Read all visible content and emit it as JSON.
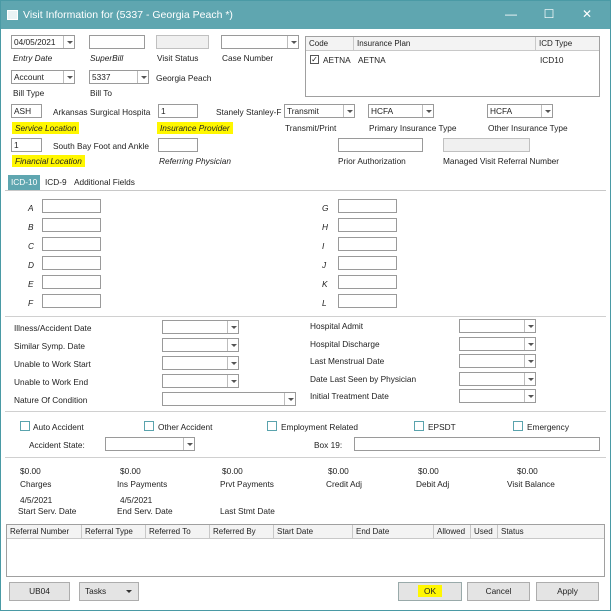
{
  "window": {
    "title": "Visit Information for (5337 - Georgia Peach *)"
  },
  "top": {
    "entry_date": "04/05/2021",
    "entry_date_label": "Entry Date",
    "superbill_label": "SuperBill",
    "visit_status_label": "Visit Status",
    "case_number_label": "Case Number",
    "bill_type_value": "Account",
    "bill_type_label": "Bill Type",
    "bill_to_value": "5337",
    "bill_to_name": "Georgia Peach",
    "bill_to_label": "Bill To",
    "service_location_code": "ASH",
    "service_location_name": "Arkansas Surgical Hospita",
    "service_location_label": "Service Location",
    "insurance_provider_code": "1",
    "insurance_provider_name": "Stanely Stanley-F",
    "insurance_provider_label": "Insurance Provider",
    "transmit_value": "Transmit",
    "transmit_label": "Transmit/Print",
    "primary_ins_type_value": "HCFA",
    "primary_ins_type_label": "Primary Insurance Type",
    "other_ins_type_value": "HCFA",
    "other_ins_type_label": "Other Insurance Type",
    "financial_location_code": "1",
    "financial_location_name": "South Bay Foot and Ankle",
    "financial_location_label": "Financial Location",
    "referring_physician_label": "Referring Physician",
    "prior_auth_label": "Prior Authorization",
    "managed_referral_label": "Managed Visit Referral Number"
  },
  "insurance_grid": {
    "headers": [
      "Code",
      "Insurance Plan",
      "ICD Type"
    ],
    "rows": [
      {
        "code": "AETNA",
        "plan": "AETNA",
        "icd_type": "ICD10",
        "checked": true
      }
    ]
  },
  "tabs": [
    "ICD-10",
    "ICD-9",
    "Additional Fields"
  ],
  "icd_letters_left": [
    "A",
    "B",
    "C",
    "D",
    "E",
    "F"
  ],
  "icd_letters_right": [
    "G",
    "H",
    "I",
    "J",
    "K",
    "L"
  ],
  "dates_left": [
    "Illness/Accident Date",
    "Similar Symp. Date",
    "Unable to Work Start",
    "Unable to Work End",
    "Nature Of Condition"
  ],
  "dates_right": [
    "Hospital Admit",
    "Hospital Discharge",
    "Last Menstrual Date",
    "Date Last Seen by Physician",
    "Initial Treatment Date"
  ],
  "checks": {
    "auto_accident": "Auto Accident",
    "other_accident": "Other Accident",
    "employment_related": "Employment Related",
    "epsdt": "EPSDT",
    "emergency": "Emergency",
    "accident_state_label": "Accident State:",
    "box19_label": "Box 19:"
  },
  "summary": {
    "charges": "$0.00",
    "charges_label": "Charges",
    "ins_payments": "$0.00",
    "ins_payments_label": "Ins Payments",
    "prvt_payments": "$0.00",
    "prvt_payments_label": "Prvt Payments",
    "credit_adj": "$0.00",
    "credit_adj_label": "Credit Adj",
    "debit_adj": "$0.00",
    "debit_adj_label": "Debit Adj",
    "visit_balance": "$0.00",
    "visit_balance_label": "Visit Balance",
    "start_date": "4/5/2021",
    "start_date_label": "Start Serv. Date",
    "end_date": "4/5/2021",
    "end_date_label": "End Serv. Date",
    "last_stmt_label": "Last Stmt Date"
  },
  "referral_grid": {
    "headers": [
      "Referral Number",
      "Referral Type",
      "Referred To",
      "Referred By",
      "Start Date",
      "End Date",
      "Allowed",
      "Used",
      "Status"
    ]
  },
  "buttons": {
    "ub04": "UB04",
    "tasks": "Tasks",
    "ok": "OK",
    "cancel": "Cancel",
    "apply": "Apply"
  },
  "colors": {
    "title_bar": "#5fa6b0",
    "highlight": "#fff700",
    "active_tab": "#5fa6b0"
  }
}
